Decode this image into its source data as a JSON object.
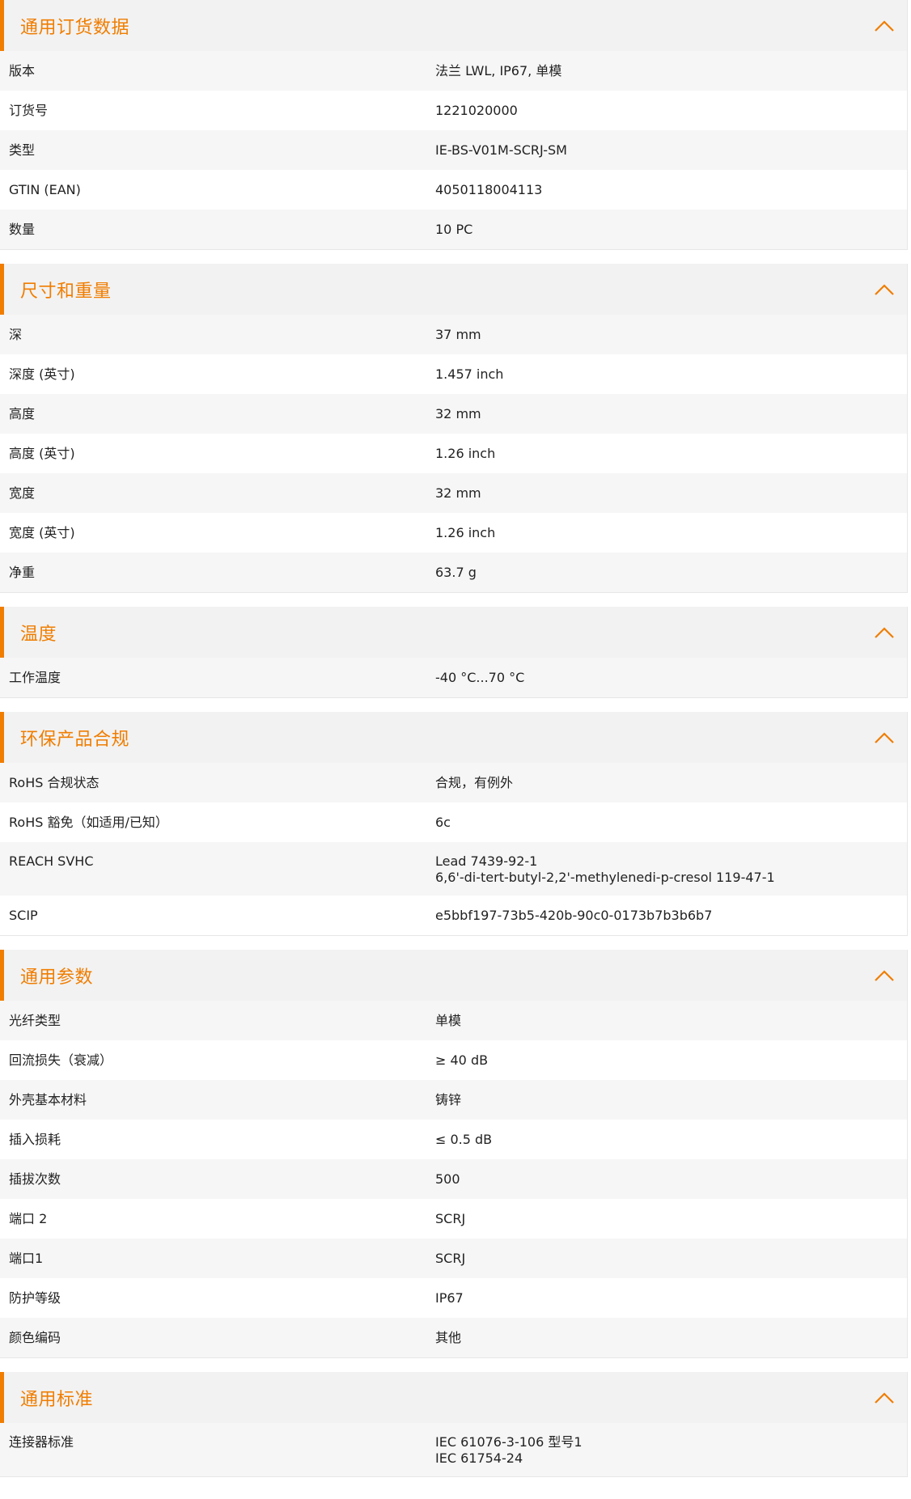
{
  "accent_color": "#f07d00",
  "icons": {
    "collapse": "chevron-up-icon"
  },
  "sections": [
    {
      "id": "ordering",
      "title": "通用订货数据",
      "rows": [
        {
          "label": "版本",
          "value": [
            "法兰 LWL, IP67, 单模"
          ]
        },
        {
          "label": "订货号",
          "value": [
            "1221020000"
          ]
        },
        {
          "label": "类型",
          "value": [
            "IE-BS-V01M-SCRJ-SM"
          ]
        },
        {
          "label": "GTIN (EAN)",
          "value": [
            "4050118004113"
          ]
        },
        {
          "label": "数量",
          "value": [
            "10  PC"
          ]
        }
      ]
    },
    {
      "id": "dimensions",
      "title": "尺寸和重量",
      "rows": [
        {
          "label": "深",
          "value": [
            "37  mm"
          ]
        },
        {
          "label": "深度 (英寸)",
          "value": [
            "1.457  inch"
          ]
        },
        {
          "label": "高度",
          "value": [
            "32  mm"
          ]
        },
        {
          "label": "高度 (英寸)",
          "value": [
            "1.26  inch"
          ]
        },
        {
          "label": "宽度",
          "value": [
            "32  mm"
          ]
        },
        {
          "label": "宽度 (英寸)",
          "value": [
            "1.26  inch"
          ]
        },
        {
          "label": "净重",
          "value": [
            "63.7  g"
          ]
        }
      ]
    },
    {
      "id": "temperature",
      "title": "温度",
      "rows": [
        {
          "label": "工作温度",
          "value": [
            "-40 °C...70 °C"
          ]
        }
      ]
    },
    {
      "id": "compliance",
      "title": "环保产品合规",
      "rows": [
        {
          "label": "RoHS 合规状态",
          "value": [
            "合规，有例外"
          ]
        },
        {
          "label": "RoHS 豁免（如适用/已知）",
          "value": [
            "6c"
          ]
        },
        {
          "label": "REACH SVHC",
          "value": [
            "Lead 7439-92-1",
            "6,6'-di-tert-butyl-2,2'-methylenedi-p-cresol 119-47-1"
          ]
        },
        {
          "label": "SCIP",
          "value": [
            "e5bbf197-73b5-420b-90c0-0173b7b3b6b7"
          ]
        }
      ]
    },
    {
      "id": "general",
      "title": "通用参数",
      "rows": [
        {
          "label": "光纤类型",
          "value": [
            "单模"
          ]
        },
        {
          "label": "回流损失（衰减）",
          "value": [
            "≥ 40 dB"
          ]
        },
        {
          "label": "外壳基本材料",
          "value": [
            "铸锌"
          ]
        },
        {
          "label": "插入损耗",
          "value": [
            "≤ 0.5 dB"
          ]
        },
        {
          "label": "插拔次数",
          "value": [
            "500"
          ]
        },
        {
          "label": "端口 2",
          "value": [
            "SCRJ"
          ]
        },
        {
          "label": "端口1",
          "value": [
            "SCRJ"
          ]
        },
        {
          "label": "防护等级",
          "value": [
            "IP67"
          ]
        },
        {
          "label": "颜色编码",
          "value": [
            "其他"
          ]
        }
      ]
    },
    {
      "id": "standards",
      "title": "通用标准",
      "rows": [
        {
          "label": "连接器标准",
          "value": [
            "IEC 61076-3-106 型号1",
            "IEC 61754-24"
          ]
        }
      ]
    }
  ]
}
